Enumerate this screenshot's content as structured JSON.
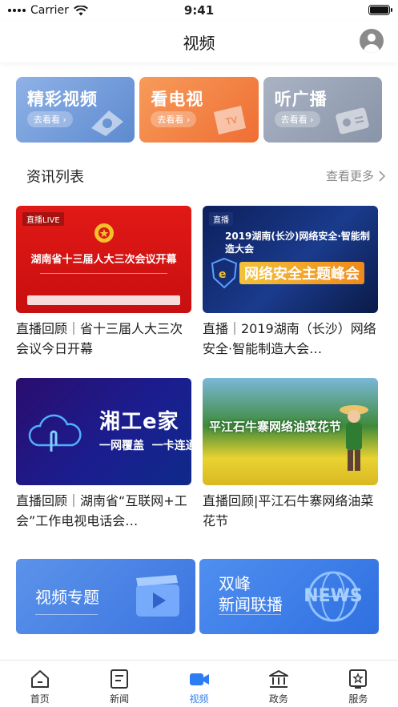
{
  "status_bar": {
    "carrier": "Carrier",
    "time": "9:41"
  },
  "header": {
    "title": "视频"
  },
  "categories": [
    {
      "title": "精彩视频",
      "action": "去看看",
      "icon": "play-disc-icon"
    },
    {
      "title": "看电视",
      "action": "去看看",
      "icon": "tv-icon"
    },
    {
      "title": "听广播",
      "action": "去看看",
      "icon": "radio-icon"
    }
  ],
  "news_section": {
    "title": "资讯列表",
    "more": "查看更多"
  },
  "news": [
    {
      "title": "直播回顾｜省十三届人大三次会议今日开幕",
      "thumb_badge": "直播LIVE",
      "thumb_caption": "湖南省十三届人大三次会议开幕"
    },
    {
      "title": "直播｜2019湖南（长沙）网络安全·智能制造大会…",
      "thumb_badge": "直播",
      "thumb_caption": "2019湖南(长沙)网络安全·智能制造大会",
      "thumb_caption2": "网络安全主题峰会"
    },
    {
      "title": "直播回顾｜湖南省“互联网+工会”工作电视电话会…",
      "thumb_caption": "湘工e家",
      "thumb_caption2": "一网覆盖  一卡连通"
    },
    {
      "title": "直播回顾|平江石牛寨网络油菜花节",
      "thumb_caption": "平江石牛寨网络油菜花节"
    }
  ],
  "banners": [
    {
      "title": "视频专题",
      "icon": "video-clapper-icon"
    },
    {
      "title_line1": "双峰",
      "title_line2": "新闻联播",
      "icon_text": "NEWS",
      "icon": "globe-news-icon"
    }
  ],
  "tabbar": {
    "active_color": "#2d7cf2",
    "items": [
      {
        "label": "首页",
        "icon": "home-icon"
      },
      {
        "label": "新闻",
        "icon": "news-icon"
      },
      {
        "label": "视频",
        "icon": "video-camera-icon",
        "active": true
      },
      {
        "label": "政务",
        "icon": "government-icon"
      },
      {
        "label": "服务",
        "icon": "service-icon"
      }
    ]
  }
}
